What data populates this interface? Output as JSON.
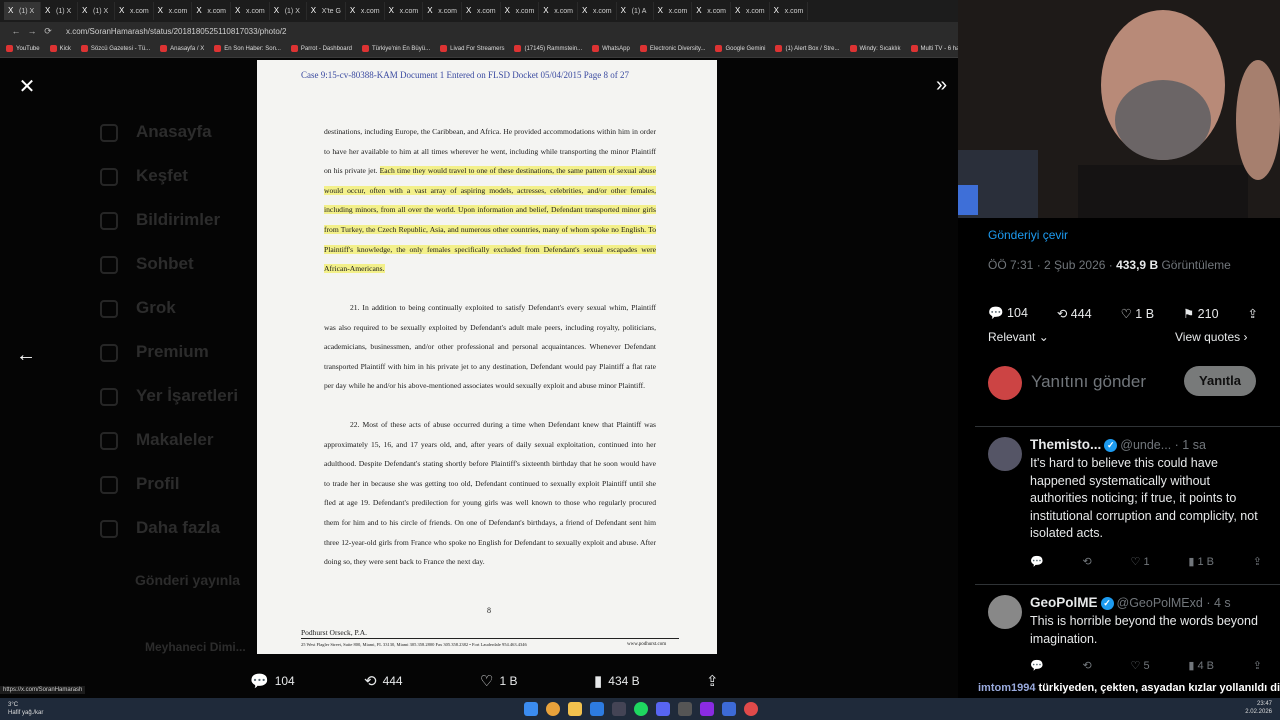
{
  "browser": {
    "tabs": [
      "(1) X",
      "(1) X",
      "(1) X",
      "x.com",
      "x.com",
      "x.com",
      "x.com",
      "(1) X",
      "X'te G",
      "x.com",
      "x.com",
      "x.com",
      "x.com",
      "x.com",
      "x.com",
      "x.com",
      "(1) A",
      "x.com",
      "x.com",
      "x.com",
      "x.com"
    ],
    "url": "x.com/SoranHamarash/status/2018180525110817033/photo/2",
    "bookmarks": [
      "YouTube",
      "Kick",
      "Sözcü Gazetesi - Tü...",
      "Anasayfa / X",
      "En Son Haber: Son...",
      "Parrot - Dashboard",
      "Türkiye'nin En Büyü...",
      "Livad For Streamers",
      "(17145) Rammstein...",
      "WhatsApp",
      "Electronic Diversity...",
      "Google Gemini",
      "(1) Alert Box / Stre...",
      "Windy: Sıcaklık",
      "Multi TV - 6 haber"
    ],
    "status_url": "https://x.com/SoranHamarash"
  },
  "dim_sidebar": [
    "Anasayfa",
    "Keşfet",
    "Bildirimler",
    "Sohbet",
    "Grok",
    "Premium",
    "Yer İşaretleri",
    "Makaleler",
    "Profil",
    "Daha fazla"
  ],
  "dim_post_button": "Gönderi yayınla",
  "dim_account": "Meyhaneci Dimi...",
  "document": {
    "header": "Case 9:15-cv-80388-KAM Document 1 Entered on FLSD Docket 05/04/2015 Page 8 of 27",
    "p1_plain": "destinations, including Europe, the Caribbean, and Africa. He provided accommodations within him in order to have her available to him at all times wherever he went, including while transporting the minor Plaintiff on his private jet.",
    "p1_highlight": "Each time they would travel to one of these destinations, the same pattern of sexual abuse would occur, often with a vast array of aspiring models, actresses, celebrities, and/or other females, including minors, from all over the world. Upon information and belief, Defendant transported minor girls from Turkey, the Czech Republic, Asia, and numerous other countries, many of whom spoke no English. To Plaintiff's knowledge, the only females specifically excluded from Defendant's sexual escapades were African-Americans.",
    "p21": "21. In addition to being continually exploited to satisfy Defendant's every sexual whim, Plaintiff was also required to be sexually exploited by Defendant's adult male peers, including royalty, politicians, academicians, businessmen, and/or other professional and personal acquaintances. Whenever Defendant transported Plaintiff with him in his private jet to any destination, Defendant would pay Plaintiff a flat rate per day while he and/or his above-mentioned associates would sexually exploit and abuse minor Plaintiff.",
    "p22": "22. Most of these acts of abuse occurred during a time when Defendant knew that Plaintiff was approximately 15, 16, and 17 years old, and, after years of daily sexual exploitation, continued into her adulthood. Despite Defendant's stating shortly before Plaintiff's sixteenth birthday that he soon would have to trade her in because she was getting too old, Defendant continued to sexually exploit Plaintiff until she fled at age 19. Defendant's predilection for young girls was well known to those who regularly procured them for him and to his circle of friends. On one of Defendant's birthdays, a friend of Defendant sent him three 12-year-old girls from France who spoke no English for Defendant to sexually exploit and abuse. After doing so, they were sent back to France the next day.",
    "page_number": "8",
    "footer_firm": "Podhurst Orseck, P.A.",
    "footer_address": "25 West Flagler Street, Suite 800, Miami, FL 33130, Miami 305.358.2800 Fax 305.358.2382 • Fort Lauderdale 954.463.4346",
    "footer_web": "www.podhurst.com"
  },
  "actionbar": {
    "replies": "104",
    "reposts": "444",
    "likes": "1 B",
    "views": "434 B"
  },
  "post": {
    "translate": "Gönderiyi çevir",
    "time": "ÖÖ 7:31 · 2 Şub 2026 · ",
    "views_count": "433,9 B",
    "views_label": " Görüntüleme",
    "replies": "104",
    "reposts": "444",
    "likes": "1 B",
    "bookmarks": "210",
    "sort": "Relevant",
    "view_quotes": "View quotes",
    "reply_placeholder": "Yanıtını gönder",
    "reply_button": "Yanıtla"
  },
  "replies": [
    {
      "name": "Themisto...",
      "handle": "@unde... · 1 sa",
      "text": "It's hard to believe this could have happened systematically without authorities noticing; if true, it points to institutional corruption and complicity, not isolated acts.",
      "likes": "1",
      "views": "1 B"
    },
    {
      "name": "GeoPolME",
      "handle": "@GeoPolMExd · 4 s",
      "text": "This is horrible beyond the words beyond imagination.",
      "likes": "5",
      "views": "4 B"
    }
  ],
  "chat_overlay": {
    "user": "imtom1994",
    "message": "türkiyeden, çekten, asyadan kızlar yollanıldı diyor"
  },
  "taskbar": {
    "weather": "3°C",
    "weather_desc": "Hafif yağ./kar",
    "time": "23:47",
    "date": "2.02.2026"
  },
  "colors": {
    "highlight": "#f3f08a",
    "verified": "#1d9bf0",
    "doc_header": "#3a4aa0"
  }
}
